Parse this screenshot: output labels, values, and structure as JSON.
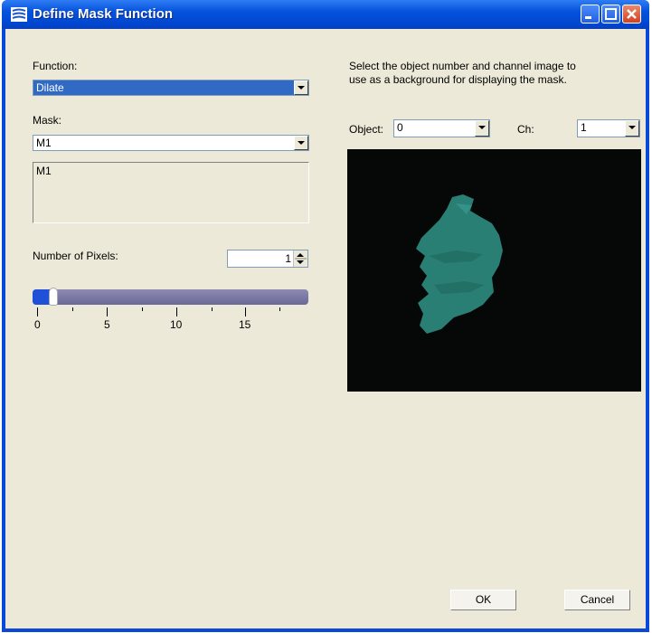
{
  "window": {
    "title": "Define Mask Function"
  },
  "left": {
    "function_label": "Function:",
    "function_value": "Dilate",
    "mask_label": "Mask:",
    "mask_value": "M1",
    "mask_list": [
      "M1"
    ],
    "pixels_label": "Number of Pixels:",
    "pixels_value": "1",
    "slider": {
      "min": 0,
      "max": 19,
      "value": 1,
      "tick_labels": [
        "0",
        "5",
        "10",
        "15"
      ]
    }
  },
  "right": {
    "instruction_line1": "Select the object number and channel image to",
    "instruction_line2": "use as a background for displaying the mask.",
    "object_label": "Object:",
    "object_value": "0",
    "channel_label": "Ch:",
    "channel_value": "1"
  },
  "buttons": {
    "ok": "OK",
    "cancel": "Cancel"
  },
  "colors": {
    "titlebar": "#0552dc",
    "client": "#ece9d8",
    "selection": "#316ac5",
    "mask_fill": "#2e8a7e",
    "slider_fill": "#2150d8",
    "slider_track": "#7a78a4"
  }
}
